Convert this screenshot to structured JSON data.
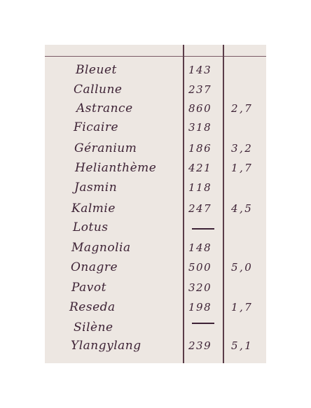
{
  "rows": [
    {
      "name": "Bleuet",
      "num": "143",
      "dec": ""
    },
    {
      "name": "Callune",
      "num": "237",
      "dec": ""
    },
    {
      "name": "Astrance",
      "num": "860",
      "dec": "2,7"
    },
    {
      "name": "Ficaire",
      "num": "318",
      "dec": ""
    },
    {
      "name": "Géranium",
      "num": "186",
      "dec": "3,2"
    },
    {
      "name": "Helianthème",
      "num": "421",
      "dec": "1,7"
    },
    {
      "name": "Jasmin",
      "num": "118",
      "dec": ""
    },
    {
      "name": "Kalmie",
      "num": "247",
      "dec": "4,5"
    },
    {
      "name": "Lotus",
      "num": "—",
      "dec": ""
    },
    {
      "name": "Magnolia",
      "num": "148",
      "dec": ""
    },
    {
      "name": "Onagre",
      "num": "500",
      "dec": "5,0"
    },
    {
      "name": "Pavot",
      "num": "320",
      "dec": ""
    },
    {
      "name": "Reseda",
      "num": "198",
      "dec": "1,7"
    },
    {
      "name": "Silène",
      "num": "—",
      "dec": ""
    },
    {
      "name": "Ylangylang",
      "num": "239",
      "dec": "5,1"
    }
  ]
}
